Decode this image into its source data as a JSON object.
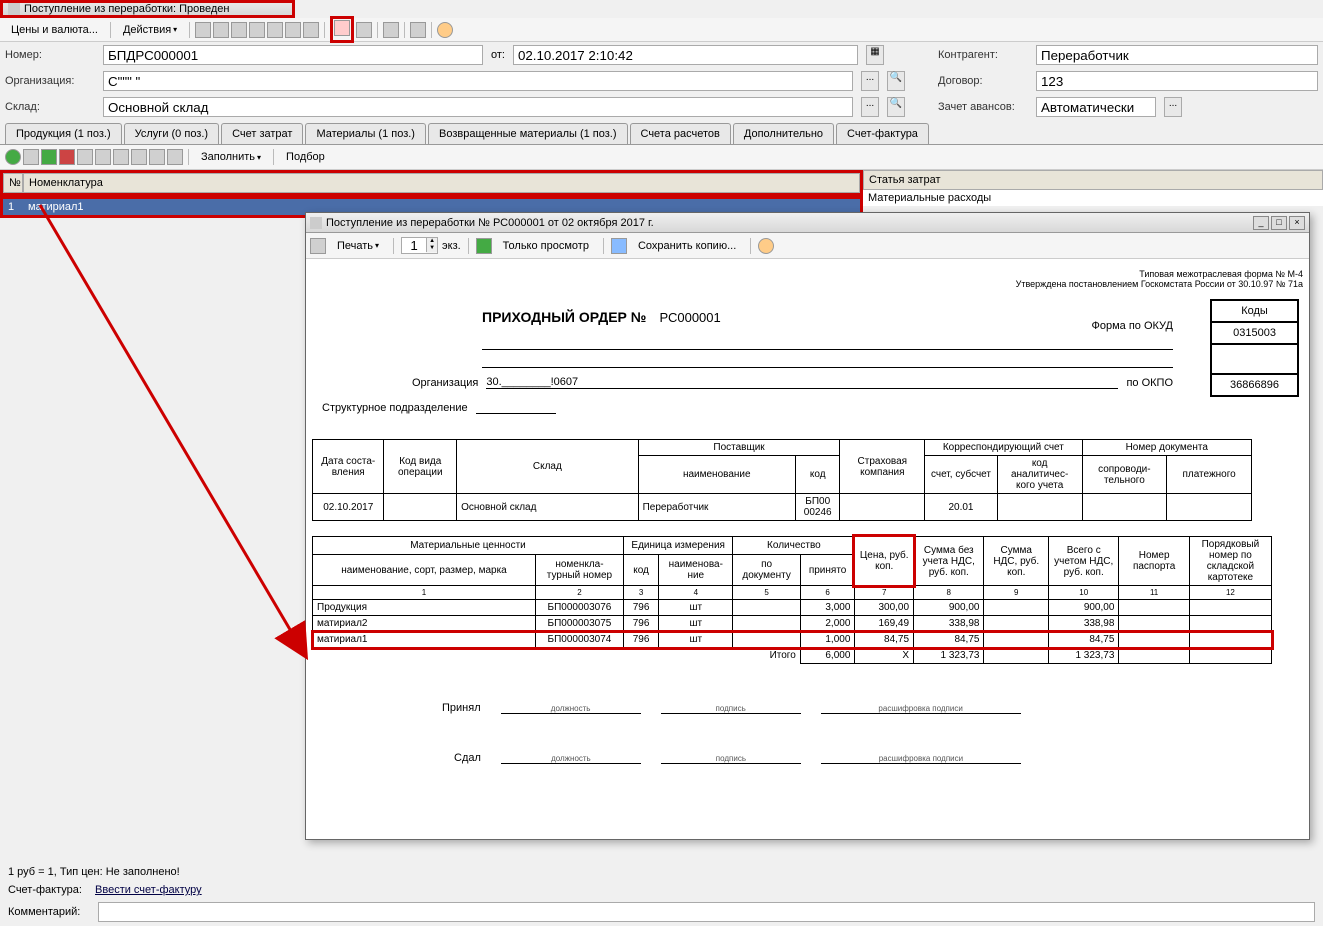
{
  "window_title": "Поступление из переработки: Проведен",
  "toolbar": {
    "prices": "Цены и валюта...",
    "actions": "Действия"
  },
  "form": {
    "number_label": "Номер:",
    "number_value": "БПДРС000001",
    "date_label": "от:",
    "date_value": "02.10.2017 2:10:42",
    "org_label": "Организация:",
    "org_value": "С\"\"\" \" ",
    "warehouse_label": "Склад:",
    "warehouse_value": "Основной склад",
    "contractor_label": "Контрагент:",
    "contractor_value": "Переработчик",
    "contract_label": "Договор:",
    "contract_value": "123",
    "advance_label": "Зачет авансов:",
    "advance_value": "Автоматически"
  },
  "tabs": {
    "products": "Продукция (1 поз.)",
    "services": "Услуги (0 поз.)",
    "cost_account": "Счет затрат",
    "materials": "Материалы (1 поз.)",
    "returned": "Возвращенные материалы (1 поз.)",
    "settlement": "Счета расчетов",
    "additional": "Дополнительно",
    "invoice": "Счет-фактура"
  },
  "subtoolbar": {
    "fill": "Заполнить",
    "select": "Подбор"
  },
  "grid": {
    "col_num": "№",
    "col_nomenclature": "Номенклатура",
    "col_cost_item": "Статья затрат",
    "row1_num": "1",
    "row1_nom": "матириал1",
    "row1_cost": "Материальные расходы"
  },
  "print_window": {
    "title": "Поступление из переработки № РС000001 от 02 октября 2017 г.",
    "print_btn": "Печать",
    "copies": "1",
    "copies_label": "экз.",
    "view_only": "Только просмотр",
    "save_copy": "Сохранить копию...",
    "form_note1": "Типовая межотраслевая форма № М-4",
    "form_note2": "Утверждена постановлением Госкомстата России от 30.10.97 № 71а",
    "codes_header": "Коды",
    "okud_code": "0315003",
    "okpo_code": "36866896",
    "okud_label": "Форма по ОКУД",
    "okpo_label": "по ОКПО",
    "doc_title": "ПРИХОДНЫЙ ОРДЕР №",
    "doc_number": "РС000001",
    "org_label": "Организация",
    "org_text": "30.________!0607",
    "struct_label": "Структурное подразделение",
    "struct_text": "____"
  },
  "table1": {
    "h_date": "Дата соста-вления",
    "h_opcode": "Код вида операции",
    "h_warehouse": "Склад",
    "h_supplier": "Поставщик",
    "h_supplier_name": "наименование",
    "h_supplier_code": "код",
    "h_insurance": "Страховая компания",
    "h_corr": "Корреспондирующий счет",
    "h_corr_acc": "счет, субсчет",
    "h_corr_code": "код аналитичес-кого учета",
    "h_docnum": "Номер документа",
    "h_docnum_acc": "сопроводи-тельного",
    "h_docnum_pay": "платежного",
    "r_date": "02.10.2017",
    "r_warehouse": "Основной склад",
    "r_supplier": "Переработчик",
    "r_code": "БП00 00246",
    "r_acc": "20.01"
  },
  "table2": {
    "h_mat": "Материальные ценности",
    "h_mat_name": "наименование, сорт, размер, марка",
    "h_mat_num": "номенкла-турный номер",
    "h_unit": "Единица измерения",
    "h_unit_code": "код",
    "h_unit_name": "наименова-ние",
    "h_qty": "Количество",
    "h_qty_doc": "по документу",
    "h_qty_acc": "принято",
    "h_price": "Цена, руб. коп.",
    "h_sum_novat": "Сумма без учета НДС, руб. коп.",
    "h_vat": "Сумма НДС, руб. коп.",
    "h_total": "Всего с учетом НДС, руб. коп.",
    "h_passport": "Номер паспорта",
    "h_cardnum": "Порядковый номер по складской картотеке",
    "total_label": "Итого",
    "rows": [
      {
        "name": "Продукция",
        "num": "БП000003076",
        "ucode": "796",
        "uname": "шт",
        "qdoc": "",
        "qacc": "3,000",
        "price": "300,00",
        "sum": "900,00",
        "vat": "",
        "total": "900,00"
      },
      {
        "name": "матириал2",
        "num": "БП000003075",
        "ucode": "796",
        "uname": "шт",
        "qdoc": "",
        "qacc": "2,000",
        "price": "169,49",
        "sum": "338,98",
        "vat": "",
        "total": "338,98"
      },
      {
        "name": "матириал1",
        "num": "БП000003074",
        "ucode": "796",
        "uname": "шт",
        "qdoc": "",
        "qacc": "1,000",
        "price": "84,75",
        "sum": "84,75",
        "vat": "",
        "total": "84,75"
      }
    ],
    "totals": {
      "qacc": "6,000",
      "price": "X",
      "sum": "1 323,73",
      "total": "1 323,73"
    }
  },
  "signatures": {
    "accepted": "Принял",
    "handed": "Сдал",
    "position": "должность",
    "signature": "подпись",
    "decipher": "расшифровка подписи"
  },
  "footer": {
    "rate_info": "1 руб = 1, Тип цен: Не заполнено!",
    "invoice_label": "Счет-фактура:",
    "invoice_link": "Ввести счет-фактуру",
    "comment_label": "Комментарий:"
  }
}
